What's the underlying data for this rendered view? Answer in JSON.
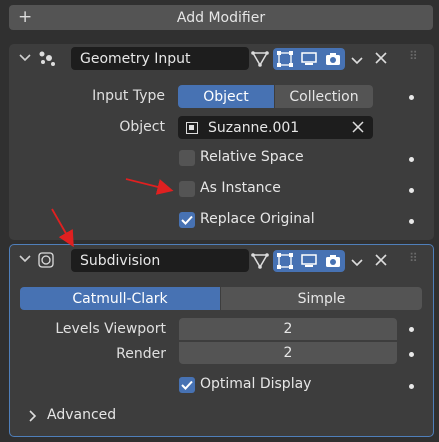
{
  "add_modifier": {
    "label": "Add Modifier"
  },
  "geometry_input": {
    "name": "Geometry Input",
    "input_type_label": "Input Type",
    "input_type_options": [
      "Object",
      "Collection"
    ],
    "input_type_selected": "Object",
    "object_label": "Object",
    "object_value": "Suzanne.001",
    "relative_space": {
      "label": "Relative Space",
      "checked": false
    },
    "as_instance": {
      "label": "As Instance",
      "checked": false
    },
    "replace_original": {
      "label": "Replace Original",
      "checked": true
    }
  },
  "subdivision": {
    "name": "Subdivision",
    "mode_options": [
      "Catmull-Clark",
      "Simple"
    ],
    "mode_selected": "Catmull-Clark",
    "levels_viewport_label": "Levels Viewport",
    "levels_viewport_value": "2",
    "render_label": "Render",
    "render_value": "2",
    "optimal_display": {
      "label": "Optimal Display",
      "checked": true
    },
    "advanced_label": "Advanced"
  },
  "colors": {
    "accent": "#4772b3",
    "panel": "#3d3d3d",
    "background": "#303030",
    "annotation_arrow": "#e02020"
  }
}
